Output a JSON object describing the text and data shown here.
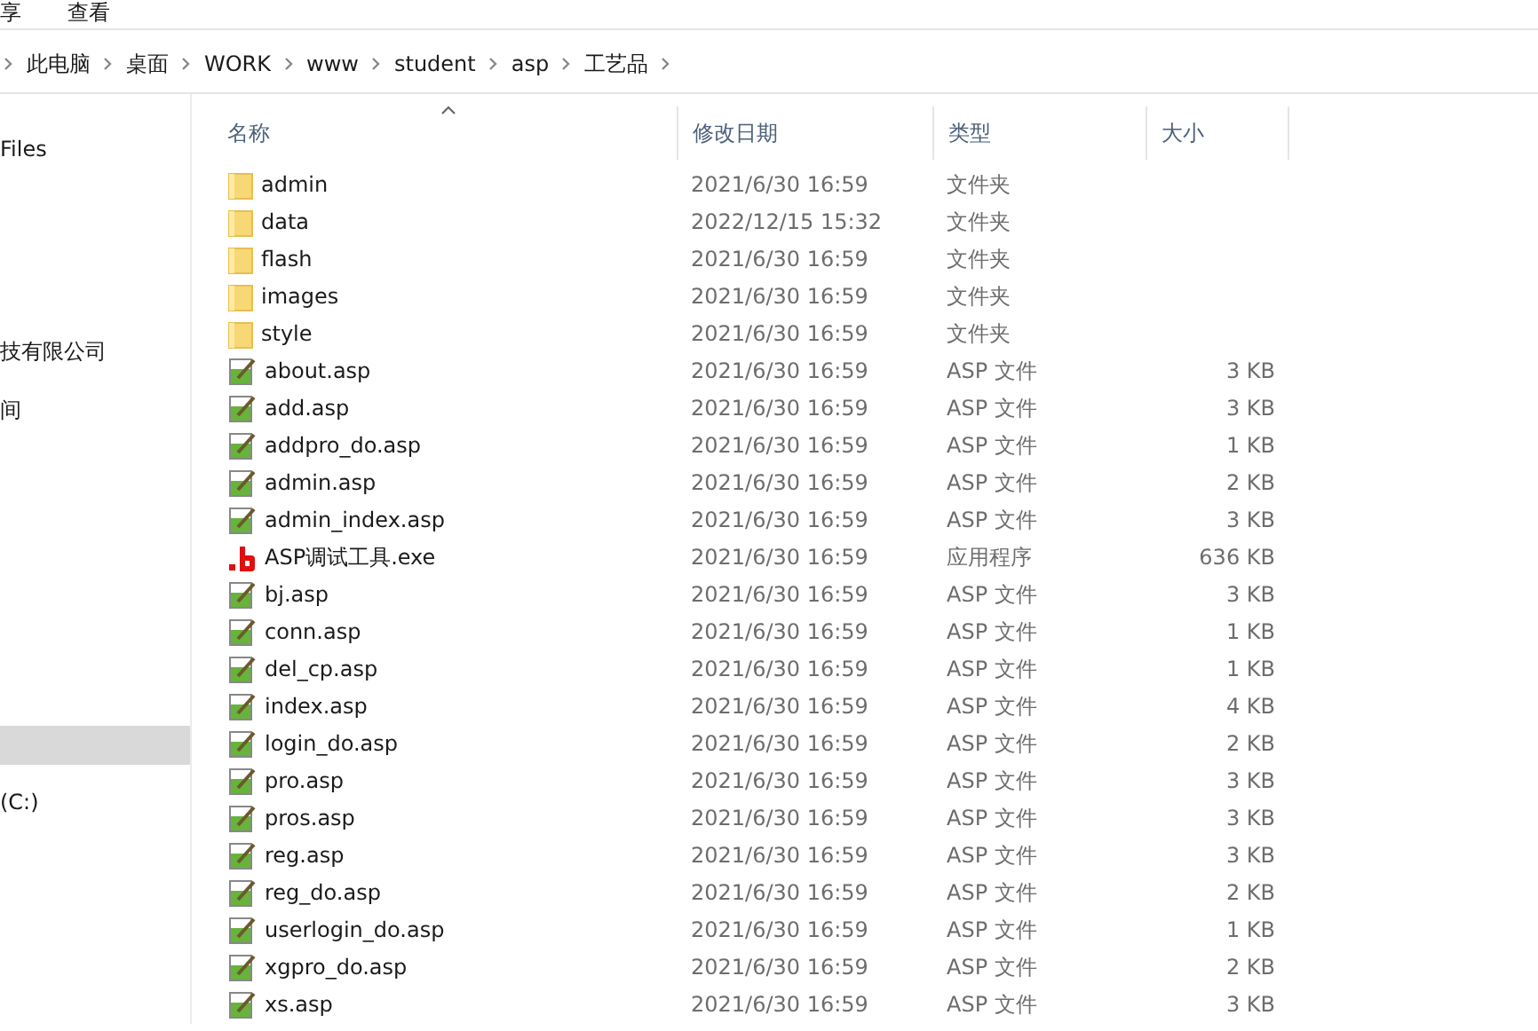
{
  "ribbon_tabs": [
    {
      "label": "享"
    },
    {
      "label": "查看"
    }
  ],
  "breadcrumb": [
    "此电脑",
    "桌面",
    "WORK",
    "www",
    "student",
    "asp",
    "工艺品"
  ],
  "sidebar": {
    "items": [
      {
        "label": "Files",
        "selected": false
      },
      {
        "label": "技有限公司",
        "selected": false
      },
      {
        "label": "间",
        "selected": false
      },
      {
        "selected": true
      },
      {
        "label": "(C:)",
        "selected": false
      }
    ]
  },
  "table": {
    "columns": [
      {
        "label": "名称",
        "sorted": true
      },
      {
        "label": "修改日期",
        "sorted": false
      },
      {
        "label": "类型",
        "sorted": false
      },
      {
        "label": "大小",
        "sorted": false
      }
    ],
    "rows": [
      {
        "kind": "folder",
        "name": "admin",
        "modified": "2021/6/30 16:59",
        "type": "文件夹"
      },
      {
        "kind": "folder",
        "name": "data",
        "modified": "2022/12/15 15:32",
        "type": "文件夹"
      },
      {
        "kind": "folder",
        "name": "flash",
        "modified": "2021/6/30 16:59",
        "type": "文件夹"
      },
      {
        "kind": "folder",
        "name": "images",
        "modified": "2021/6/30 16:59",
        "type": "文件夹"
      },
      {
        "kind": "folder",
        "name": "style",
        "modified": "2021/6/30 16:59",
        "type": "文件夹"
      },
      {
        "kind": "asp",
        "name": "about.asp",
        "modified": "2021/6/30 16:59",
        "type": "ASP 文件",
        "size": "3 KB"
      },
      {
        "kind": "asp",
        "name": "add.asp",
        "modified": "2021/6/30 16:59",
        "type": "ASP 文件",
        "size": "3 KB"
      },
      {
        "kind": "asp",
        "name": "addpro_do.asp",
        "modified": "2021/6/30 16:59",
        "type": "ASP 文件",
        "size": "1 KB"
      },
      {
        "kind": "asp",
        "name": "admin.asp",
        "modified": "2021/6/30 16:59",
        "type": "ASP 文件",
        "size": "2 KB"
      },
      {
        "kind": "asp",
        "name": "admin_index.asp",
        "modified": "2021/6/30 16:59",
        "type": "ASP 文件",
        "size": "3 KB"
      },
      {
        "kind": "exe",
        "name": "ASP调试工具.exe",
        "modified": "2021/6/30 16:59",
        "type": "应用程序",
        "size": "636 KB"
      },
      {
        "kind": "asp",
        "name": "bj.asp",
        "modified": "2021/6/30 16:59",
        "type": "ASP 文件",
        "size": "3 KB"
      },
      {
        "kind": "asp",
        "name": "conn.asp",
        "modified": "2021/6/30 16:59",
        "type": "ASP 文件",
        "size": "1 KB"
      },
      {
        "kind": "asp",
        "name": "del_cp.asp",
        "modified": "2021/6/30 16:59",
        "type": "ASP 文件",
        "size": "1 KB"
      },
      {
        "kind": "asp",
        "name": "index.asp",
        "modified": "2021/6/30 16:59",
        "type": "ASP 文件",
        "size": "4 KB"
      },
      {
        "kind": "asp",
        "name": "login_do.asp",
        "modified": "2021/6/30 16:59",
        "type": "ASP 文件",
        "size": "2 KB"
      },
      {
        "kind": "asp",
        "name": "pro.asp",
        "modified": "2021/6/30 16:59",
        "type": "ASP 文件",
        "size": "3 KB"
      },
      {
        "kind": "asp",
        "name": "pros.asp",
        "modified": "2021/6/30 16:59",
        "type": "ASP 文件",
        "size": "3 KB"
      },
      {
        "kind": "asp",
        "name": "reg.asp",
        "modified": "2021/6/30 16:59",
        "type": "ASP 文件",
        "size": "3 KB"
      },
      {
        "kind": "asp",
        "name": "reg_do.asp",
        "modified": "2021/6/30 16:59",
        "type": "ASP 文件",
        "size": "2 KB"
      },
      {
        "kind": "asp",
        "name": "userlogin_do.asp",
        "modified": "2021/6/30 16:59",
        "type": "ASP 文件",
        "size": "1 KB"
      },
      {
        "kind": "asp",
        "name": "xgpro_do.asp",
        "modified": "2021/6/30 16:59",
        "type": "ASP 文件",
        "size": "2 KB"
      },
      {
        "kind": "asp",
        "name": "xs.asp",
        "modified": "2021/6/30 16:59",
        "type": "ASP 文件",
        "size": "3 KB"
      }
    ]
  }
}
